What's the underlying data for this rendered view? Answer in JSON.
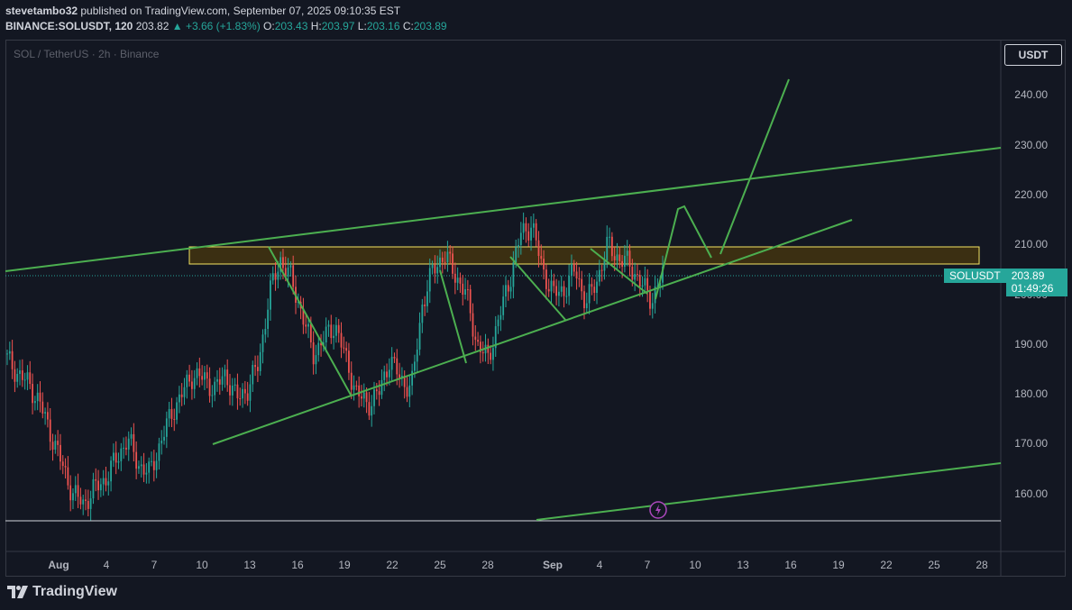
{
  "header": {
    "author": "stevetambo32",
    "published_text": " published on TradingView.com, September 07, 2025 09:10:35 EST",
    "symbol": "BINANCE:SOLUSDT, 120",
    "last": "203.82",
    "change": "▲ +3.66 (+1.83%)",
    "o_label": "O:",
    "o_value": "203.43",
    "h_label": "H:",
    "h_value": "203.97",
    "l_label": "L:",
    "l_value": "203.16",
    "c_label": "C:",
    "c_value": "203.89"
  },
  "watermark": "SOL / TetherUS · 2h · Binance",
  "currency_button": "USDT",
  "price_axis": [
    "240.00",
    "230.00",
    "220.00",
    "210.00",
    "200.00",
    "190.00",
    "180.00",
    "170.00",
    "160.00"
  ],
  "time_axis": [
    "Aug",
    "4",
    "7",
    "10",
    "13",
    "16",
    "19",
    "22",
    "25",
    "28",
    "Sep",
    "4",
    "7",
    "10",
    "13",
    "16",
    "19",
    "22",
    "25",
    "28"
  ],
  "last_price": {
    "symbol": "SOLUSDT",
    "price": "203.89",
    "countdown": "01:49:26"
  },
  "logo_text": "TradingView",
  "colors": {
    "background": "#131722",
    "up": "#26a69a",
    "down": "#ef5350",
    "trendline": "#4caf50",
    "zone_border": "#f5e663",
    "zone_fill": "#3b2f12"
  },
  "chart_data": {
    "type": "candlestick",
    "symbol": "SOLUSDT",
    "interval": "2h",
    "y_range": [
      155,
      245
    ],
    "resistance_zone": [
      206.5,
      209.8
    ],
    "last_price": 203.89,
    "current_close_sample": [
      187,
      184,
      182,
      178,
      172,
      166,
      160,
      158,
      161,
      163,
      167,
      171,
      166,
      164,
      170,
      176,
      180,
      184,
      183,
      181,
      184,
      179,
      181,
      186,
      200,
      207,
      203,
      196,
      188,
      191,
      194,
      187,
      180,
      178,
      180,
      187,
      183,
      181,
      198,
      205,
      208,
      204,
      200,
      190,
      187,
      195,
      203,
      212,
      214,
      205,
      200,
      201,
      205,
      198,
      203,
      210,
      207,
      206,
      202,
      199,
      203.89
    ]
  }
}
